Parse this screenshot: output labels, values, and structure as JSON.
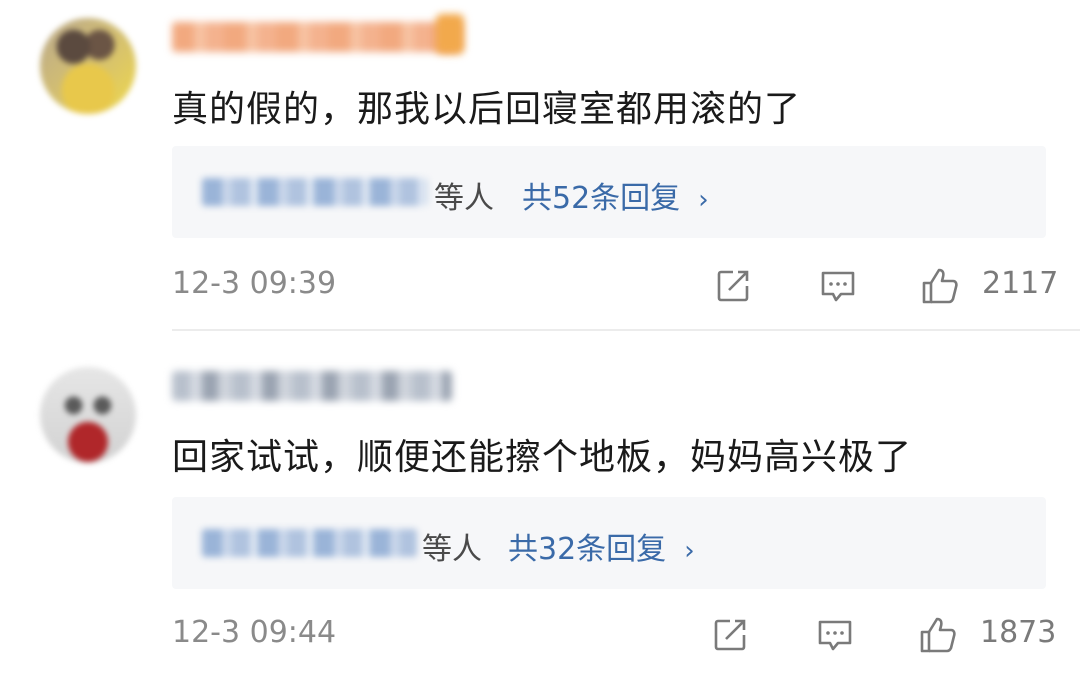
{
  "comments": [
    {
      "text": "真的假的，那我以后回寝室都用滚的了",
      "replies": {
        "people_label": "等人",
        "count_label": "共52条回复",
        "chevron": "›"
      },
      "timestamp": "12-3 09:39",
      "likes": "2117"
    },
    {
      "text": "回家试试，顺便还能擦个地板，妈妈高兴极了",
      "replies": {
        "people_label": "等人",
        "count_label": "共32条回复",
        "chevron": "›"
      },
      "timestamp": "12-3 09:44",
      "likes": "1873"
    }
  ],
  "icons": {
    "share": "share-icon",
    "comment": "comment-icon",
    "like": "thumbs-up-icon"
  },
  "colors": {
    "reply_link": "#3a6aa8",
    "meta": "#8a8a8a",
    "reply_bg": "#f6f7f9"
  }
}
